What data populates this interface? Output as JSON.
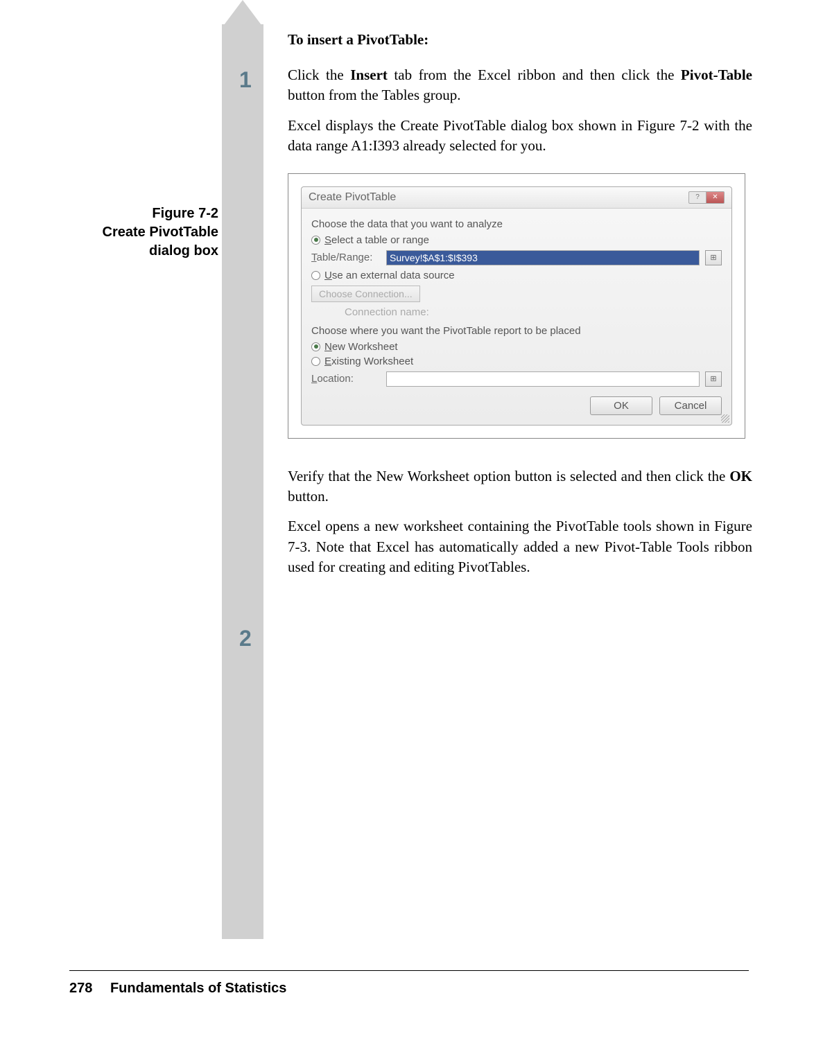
{
  "heading": "To insert a PivotTable:",
  "steps": {
    "s1": {
      "num": "1",
      "p1a": "Click the ",
      "p1b": "Insert",
      "p1c": " tab from the Excel ribbon and then click the ",
      "p1d": "Pivot-Table",
      "p1e": " button from the Tables group.",
      "p2": "Excel displays the Create PivotTable dialog box shown in Figure 7-2 with the data range A1:I393 already selected for you."
    },
    "s2": {
      "num": "2",
      "p1a": "Verify that the New Worksheet option button is selected and then click the ",
      "p1b": "OK",
      "p1c": " button.",
      "p2": "Excel opens a new worksheet containing the PivotTable tools shown in Figure 7-3. Note that Excel has automatically added a new Pivot-Table Tools ribbon used for creating and editing PivotTables."
    }
  },
  "figure_caption": {
    "line1": "Figure 7-2",
    "line2": "Create PivotTable",
    "line3": "dialog box"
  },
  "dialog": {
    "title": "Create PivotTable",
    "help": "?",
    "close": "✕",
    "section1": "Choose the data that you want to analyze",
    "opt_select_pre": "S",
    "opt_select_post": "elect a table or range",
    "table_range_pre": "T",
    "table_range_post": "able/Range:",
    "table_range_value": "Survey!$A$1:$I$393",
    "opt_external_pre": "U",
    "opt_external_post": "se an external data source",
    "choose_conn": "Choose Connection...",
    "conn_name": "Connection name:",
    "section2": "Choose where you want the PivotTable report to be placed",
    "opt_new_pre": "N",
    "opt_new_post": "ew Worksheet",
    "opt_existing_pre": "E",
    "opt_existing_post": "xisting Worksheet",
    "location_pre": "L",
    "location_post": "ocation:",
    "ok": "OK",
    "cancel": "Cancel",
    "ref_icon": "⊞"
  },
  "footer": {
    "page": "278",
    "title": "Fundamentals of Statistics"
  }
}
